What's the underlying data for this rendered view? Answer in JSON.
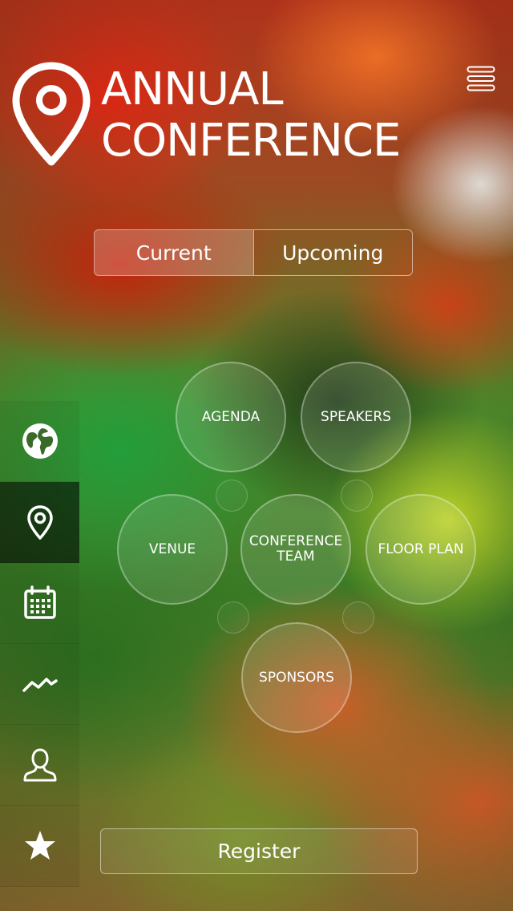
{
  "app": {
    "title_line1": "ANNUAL",
    "title_line2": "CONFERENCE",
    "logo_icon": "map-pin-icon",
    "menu_icon": "hamburger-menu-icon"
  },
  "tabs": [
    {
      "label": "Current",
      "active": true
    },
    {
      "label": "Upcoming",
      "active": false
    }
  ],
  "sidebar": {
    "items": [
      {
        "icon": "globe-icon",
        "active": false
      },
      {
        "icon": "location-pin-icon",
        "active": true
      },
      {
        "icon": "calendar-icon",
        "active": false
      },
      {
        "icon": "trend-chart-icon",
        "active": false
      },
      {
        "icon": "user-icon",
        "active": false
      },
      {
        "icon": "star-icon",
        "active": false
      }
    ]
  },
  "menu": {
    "agenda": "AGENDA",
    "speakers": "SPEAKERS",
    "venue": "VENUE",
    "conference_team_line1": "CONFERENCE",
    "conference_team_line2": "TEAM",
    "floor_plan": "FLOOR PLAN",
    "sponsors": "SPONSORS"
  },
  "register_label": "Register",
  "colors": {
    "text": "#ffffff",
    "active_sidebar": "#000000"
  }
}
